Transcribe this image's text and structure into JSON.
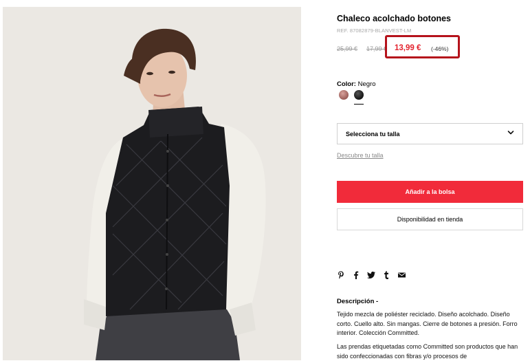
{
  "product": {
    "image_alt": "Chaleco acolchado botones",
    "title": "Chaleco acolchado botones",
    "reference": "REF. 87082879-BLANVEST-LM",
    "price": {
      "original": "25,99 €",
      "previous": "17,99 €",
      "current": "13,99 €",
      "discount": "(-46%)"
    },
    "color": {
      "label": "Color:",
      "selected": "Negro",
      "swatches": [
        {
          "name": "rose-swatch",
          "hex": "#b9716b"
        },
        {
          "name": "black-swatch",
          "hex": "#1f1f1f"
        }
      ]
    },
    "size": {
      "placeholder": "Selecciona tu talla",
      "guide_link": "Descubre tu talla"
    },
    "actions": {
      "add_to_bag": "Añadir a la bolsa",
      "store_availability": "Disponibilidad en tienda"
    },
    "share_icons": [
      "pinterest-icon",
      "facebook-icon",
      "twitter-icon",
      "tumblr-icon",
      "email-icon"
    ],
    "description": {
      "title": "Descripción -",
      "paragraph1": "Tejido mezcla de poliéster reciclado. Diseño acolchado. Diseño corto. Cuello alto. Sin mangas. Cierre de botones a presión. Forro interior. Colección Committed.",
      "paragraph2": "Las prendas etiquetadas como Committed son productos que han sido confeccionadas con fibras y/o procesos de"
    }
  },
  "colors": {
    "accent_red": "#f12b3a",
    "price_red": "#e3232e",
    "highlight_border": "#b5121b"
  }
}
